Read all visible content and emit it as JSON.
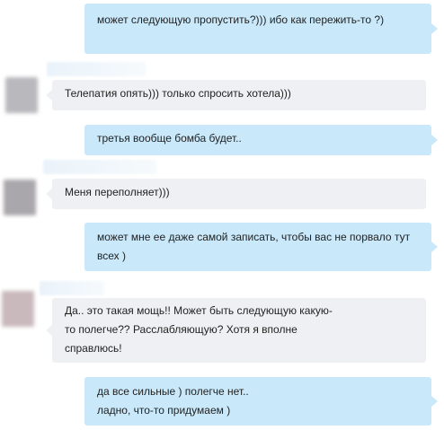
{
  "messages": [
    {
      "id": "m1",
      "direction": "outgoing",
      "text": "может следующую пропустить?))) ибо как пережить-то ?)"
    },
    {
      "id": "m2",
      "direction": "incoming",
      "text": "Телепатия опять))) только спросить хотела)))"
    },
    {
      "id": "m3",
      "direction": "outgoing",
      "text": "третья вообще бомба будет.."
    },
    {
      "id": "m4",
      "direction": "incoming",
      "text": "Меня переполняет)))"
    },
    {
      "id": "m5",
      "direction": "outgoing",
      "text": "может мне ее даже самой записать, чтобы вас не порвало тут всех )"
    },
    {
      "id": "m6",
      "direction": "incoming",
      "text": "Да.. это такая мощь!! Может быть следующую какую-то полегче?? Расслабляющую? Хотя я вполне справлюсь!"
    },
    {
      "id": "m7",
      "direction": "outgoing",
      "text": "да все сильные ) полегче нет..\nладно, что-то придумаем )"
    }
  ],
  "colors": {
    "outgoing_bubble": "#c9e9fb",
    "incoming_bubble": "#eef0f3",
    "avatar_1": "#b8b8bd",
    "avatar_2": "#a9a7ab",
    "avatar_3": "#c9b9bd"
  }
}
